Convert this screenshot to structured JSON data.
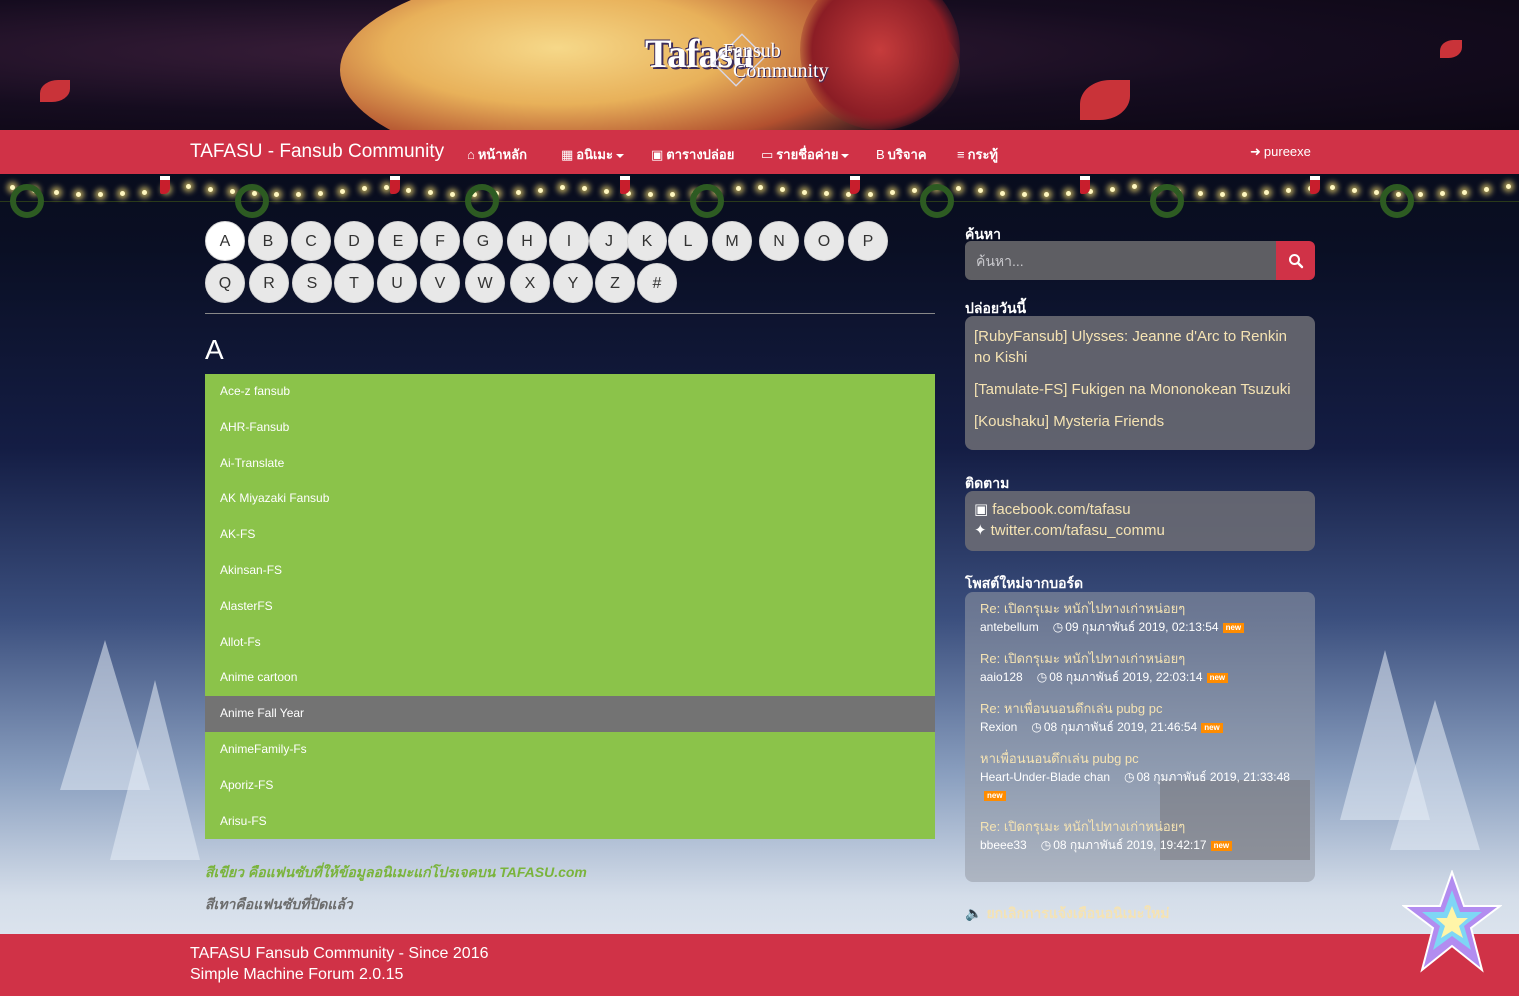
{
  "banner": {
    "logo_line1": "Tafasu",
    "logo_line2": "Fansub",
    "logo_line3": "Community"
  },
  "navbar": {
    "brand": "TAFASU - Fansub Community",
    "items": [
      {
        "label": "หน้าหลัก",
        "icon": "home-icon"
      },
      {
        "label": "อนิเมะ",
        "icon": "film-icon"
      },
      {
        "label": "ตารางปล่อย",
        "icon": "calendar-icon"
      },
      {
        "label": "รายชื่อค่าย",
        "icon": "folder-open-icon"
      },
      {
        "label": "บริจาค",
        "icon": "bitcoin-icon"
      },
      {
        "label": "กระทู้",
        "icon": "bars-icon"
      }
    ],
    "user": "pureexe"
  },
  "alphabet": [
    "A",
    "B",
    "C",
    "D",
    "E",
    "F",
    "G",
    "H",
    "I",
    "J",
    "K",
    "L",
    "M",
    "N",
    "O",
    "P",
    "Q",
    "R",
    "S",
    "T",
    "U",
    "V",
    "W",
    "X",
    "Y",
    "Z",
    "#"
  ],
  "section_heading": "A",
  "fansubs": [
    {
      "name": "Ace-z fansub",
      "closed": false
    },
    {
      "name": "AHR-Fansub",
      "closed": false
    },
    {
      "name": "Ai-Translate",
      "closed": false
    },
    {
      "name": "AK Miyazaki Fansub",
      "closed": false
    },
    {
      "name": "AK-FS",
      "closed": false
    },
    {
      "name": "Akinsan-FS",
      "closed": false
    },
    {
      "name": "AlasterFS",
      "closed": false
    },
    {
      "name": "Allot-Fs",
      "closed": false
    },
    {
      "name": "Anime cartoon",
      "closed": false
    },
    {
      "name": "Anime Fall Year",
      "closed": true
    },
    {
      "name": "AnimeFamily-Fs",
      "closed": false
    },
    {
      "name": "Aporiz-FS",
      "closed": false
    },
    {
      "name": "Arisu-FS",
      "closed": false
    }
  ],
  "notes": {
    "green": "สีเขียว คือแฟนซับที่ให้ข้อมูลอนิเมะแก่โปรเจคบน TAFASU.com",
    "gray": "สีเทาคือแฟนซับที่ปิดแล้ว"
  },
  "sidebar": {
    "search_title": "ค้นหา",
    "search_placeholder": "ค้นหา...",
    "today_title": "ปล่อยวันนี้",
    "today": [
      "[RubyFansub] Ulysses: Jeanne d'Arc to Renkin no Kishi",
      "[Tamulate-FS] Fukigen na Mononokean Tsuzuki",
      "[Koushaku] Mysteria Friends"
    ],
    "follow_title": "ติดตาม",
    "follow": [
      {
        "label": "facebook.com/tafasu",
        "icon": "facebook-icon"
      },
      {
        "label": "twitter.com/tafasu_commu",
        "icon": "twitter-icon"
      }
    ],
    "posts_title": "โพสต์ใหม่จากบอร์ด",
    "posts": [
      {
        "title": "Re: เปิดกรุเมะ หนักไปทางเก่าหน่อยๆ",
        "author": "antebellum",
        "time": "09 กุมภาพันธ์ 2019, 02:13:54",
        "badge": "new"
      },
      {
        "title": "Re: เปิดกรุเมะ หนักไปทางเก่าหน่อยๆ",
        "author": "aaio128",
        "time": "08 กุมภาพันธ์ 2019, 22:03:14",
        "badge": "new"
      },
      {
        "title": "Re: หาเพื่อนนอนดึกเล่น pubg pc",
        "author": "Rexion",
        "time": "08 กุมภาพันธ์ 2019, 21:46:54",
        "badge": "new"
      },
      {
        "title": "หาเพื่อนนอนดึกเล่น pubg pc",
        "author": "Heart-Under-Blade chan",
        "time": "08 กุมภาพันธ์ 2019, 21:33:48",
        "badge": "new"
      },
      {
        "title": "Re: เปิดกรุเมะ หนักไปทางเก่าหน่อยๆ",
        "author": "bbeee33",
        "time": "08 กุมภาพันธ์ 2019, 19:42:17",
        "badge": "new"
      }
    ],
    "unsubscribe": "ยกเลิกการแจ้งเตือนอนิเมะใหม่"
  },
  "footer": {
    "line1": "TAFASU Fansub Community - Since 2016",
    "line2": "Simple Machine Forum 2.0.15"
  },
  "colors": {
    "nav_red": "#d03247",
    "active_green": "#8bc34a",
    "closed_gray": "#737373",
    "link_cream": "#f5e3b3"
  }
}
